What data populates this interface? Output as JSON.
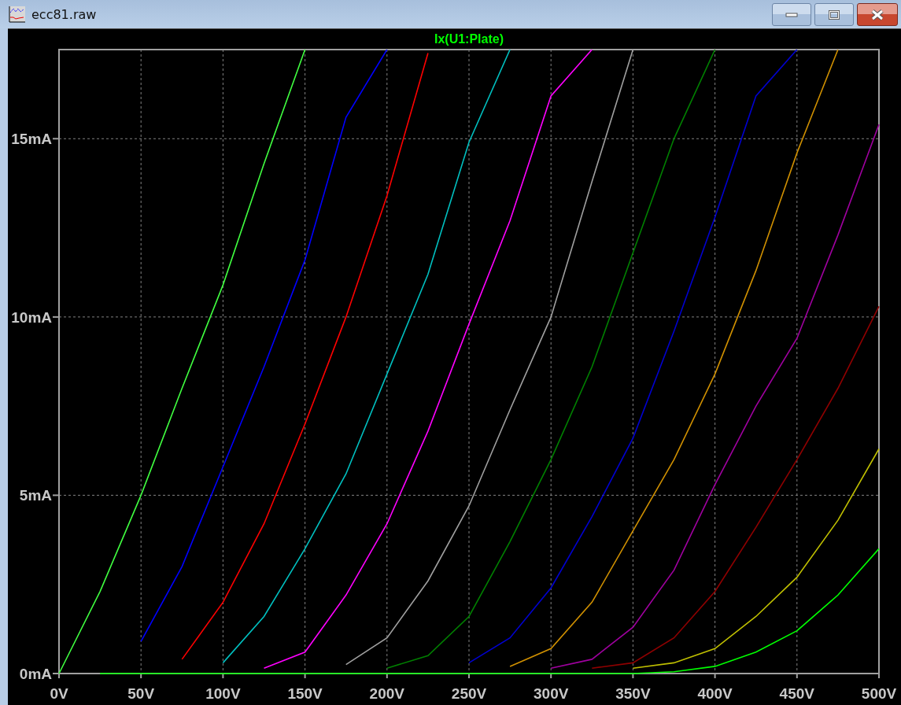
{
  "window": {
    "title": "ecc81.raw"
  },
  "plot": {
    "chart_data": {
      "type": "line",
      "title": "Ix(U1:Plate)",
      "grid": true,
      "xlim": [
        0,
        500
      ],
      "ylim": [
        0,
        17.5
      ],
      "xticks": [
        {
          "value": 0,
          "label": "0V"
        },
        {
          "value": 50,
          "label": "50V"
        },
        {
          "value": 100,
          "label": "100V"
        },
        {
          "value": 150,
          "label": "150V"
        },
        {
          "value": 200,
          "label": "200V"
        },
        {
          "value": 250,
          "label": "250V"
        },
        {
          "value": 300,
          "label": "300V"
        },
        {
          "value": 350,
          "label": "350V"
        },
        {
          "value": 400,
          "label": "400V"
        },
        {
          "value": 450,
          "label": "450V"
        },
        {
          "value": 500,
          "label": "500V"
        }
      ],
      "yticks": [
        {
          "value": 0,
          "label": "0mA"
        },
        {
          "value": 5,
          "label": "5mA"
        },
        {
          "value": 10,
          "label": "10mA"
        },
        {
          "value": 15,
          "label": "15mA"
        }
      ],
      "x": [
        0,
        25,
        50,
        75,
        100,
        125,
        150,
        175,
        200,
        225,
        250,
        275,
        300,
        325,
        350,
        375,
        400,
        425,
        450,
        475,
        500
      ],
      "series": [
        {
          "color": "#40ff40",
          "values": [
            0,
            2.3,
            5,
            8,
            10.9,
            14.3,
            17.5,
            null,
            null,
            null,
            null,
            null,
            null,
            null,
            null,
            null,
            null,
            null,
            null,
            null,
            null
          ]
        },
        {
          "color": "#0000ff",
          "values": [
            null,
            null,
            0.9,
            3.0,
            5.8,
            8.6,
            11.6,
            15.6,
            17.5,
            null,
            null,
            null,
            null,
            null,
            null,
            null,
            null,
            null,
            null,
            null,
            null
          ]
        },
        {
          "color": "#ff0000",
          "values": [
            null,
            null,
            null,
            0.4,
            2.0,
            4.2,
            7.0,
            10,
            13.4,
            17.4,
            null,
            null,
            null,
            null,
            null,
            null,
            null,
            null,
            null,
            null,
            null
          ]
        },
        {
          "color": "#00c0c0",
          "values": [
            null,
            null,
            null,
            null,
            0.3,
            1.6,
            3.5,
            5.6,
            8.4,
            11.2,
            14.9,
            17.5,
            null,
            null,
            null,
            null,
            null,
            null,
            null,
            null,
            null
          ]
        },
        {
          "color": "#ff00ff",
          "values": [
            null,
            null,
            null,
            null,
            null,
            0.15,
            0.6,
            2.2,
            4.2,
            6.8,
            9.8,
            12.7,
            16.2,
            17.5,
            null,
            null,
            null,
            null,
            null,
            null,
            null
          ]
        },
        {
          "color": "#a0a0a0",
          "values": [
            null,
            null,
            null,
            null,
            null,
            null,
            null,
            0.25,
            1.0,
            2.6,
            4.7,
            7.4,
            10,
            13.8,
            17.5,
            null,
            null,
            null,
            null,
            null,
            null
          ]
        },
        {
          "color": "#008000",
          "values": [
            null,
            null,
            null,
            null,
            null,
            null,
            null,
            null,
            0.15,
            0.5,
            1.6,
            3.7,
            6.0,
            8.6,
            11.8,
            15,
            17.5,
            null,
            null,
            null,
            null
          ]
        },
        {
          "color": "#0000d0",
          "values": [
            null,
            null,
            null,
            null,
            null,
            null,
            null,
            null,
            null,
            null,
            0.3,
            1.0,
            2.4,
            4.4,
            6.6,
            9.6,
            12.8,
            16.2,
            17.5,
            null,
            null
          ]
        },
        {
          "color": "#d09000",
          "values": [
            null,
            null,
            null,
            null,
            null,
            null,
            null,
            null,
            null,
            null,
            null,
            0.2,
            0.7,
            2.0,
            4.0,
            6.0,
            8.4,
            11.3,
            14.6,
            17.5,
            null
          ]
        },
        {
          "color": "#a000a0",
          "values": [
            null,
            null,
            null,
            null,
            null,
            null,
            null,
            null,
            null,
            null,
            null,
            null,
            0.15,
            0.4,
            1.3,
            2.9,
            5.3,
            7.5,
            9.4,
            12.3,
            15.4
          ]
        },
        {
          "color": "#900000",
          "values": [
            null,
            null,
            null,
            null,
            null,
            null,
            null,
            null,
            null,
            null,
            null,
            null,
            null,
            0.15,
            0.3,
            1.0,
            2.3,
            4.1,
            6.0,
            8.0,
            10.3
          ]
        },
        {
          "color": "#c0c000",
          "values": [
            null,
            null,
            null,
            null,
            null,
            null,
            null,
            null,
            null,
            null,
            null,
            null,
            null,
            null,
            0.15,
            0.3,
            0.7,
            1.6,
            2.7,
            4.3,
            6.3
          ]
        },
        {
          "color": "#00ff00",
          "values": [
            null,
            0,
            0,
            0,
            0,
            0,
            0,
            0,
            0,
            0,
            0,
            0,
            0,
            0,
            0,
            0.05,
            0.2,
            0.6,
            1.2,
            2.2,
            3.5
          ]
        }
      ]
    }
  }
}
